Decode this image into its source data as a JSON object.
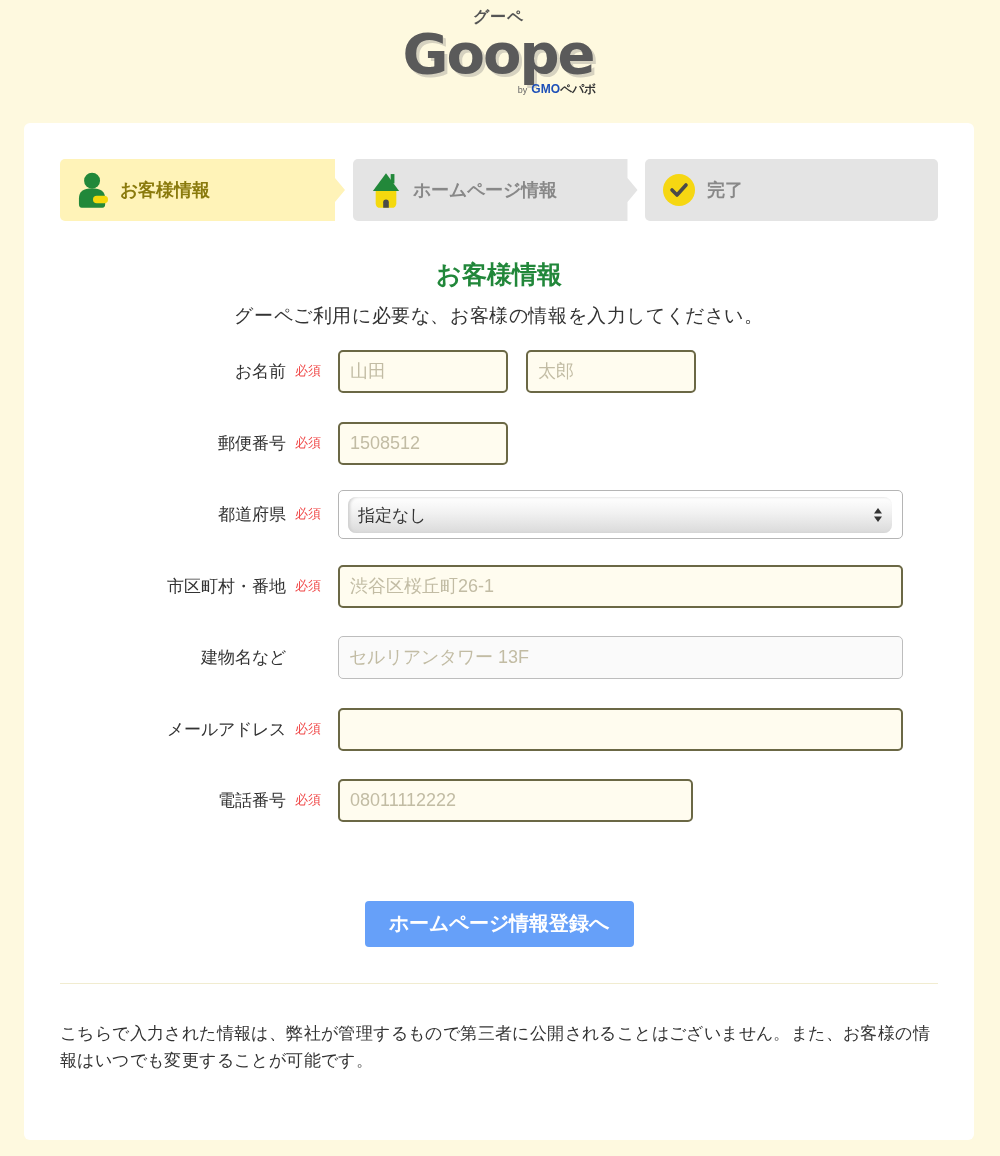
{
  "logo": {
    "kana": "グーペ",
    "wordmark": "Goope",
    "byline": "by",
    "company_prefix": "GMO",
    "company_name": "ペパボ"
  },
  "steps": [
    {
      "label": "お客様情報",
      "kind": "person",
      "selected": true
    },
    {
      "label": "ホームページ情報",
      "kind": "house",
      "selected": false
    },
    {
      "label": "完了",
      "kind": "check",
      "selected": false
    }
  ],
  "heading": "お客様情報",
  "intro": "グーペご利用に必要な、お客様の情報を入力してください。",
  "fields": [
    {
      "label": "お名前",
      "kind": "name",
      "required": true,
      "required_label": "必須",
      "inputs": [
        {
          "placeholder": "山田"
        },
        {
          "placeholder": "太郎"
        }
      ]
    },
    {
      "label": "郵便番号",
      "kind": "postal",
      "required": true,
      "required_label": "必須",
      "placeholder": "1508512"
    },
    {
      "label": "都道府県",
      "kind": "select",
      "required": true,
      "required_label": "必須",
      "value": "指定なし"
    },
    {
      "label": "市区町村・番地",
      "kind": "text",
      "required": true,
      "required_label": "必須",
      "placeholder": "渋谷区桜丘町26-1"
    },
    {
      "label": "建物名など",
      "kind": "text",
      "required": false,
      "placeholder": "セルリアンタワー 13F"
    },
    {
      "label": "メールアドレス",
      "kind": "text",
      "required": true,
      "required_label": "必須"
    },
    {
      "label": "電話番号",
      "kind": "phone",
      "required": true,
      "required_label": "必須",
      "placeholder": "08011112222"
    }
  ],
  "submit": "ホームページ情報登録へ",
  "note": "こちらで入力された情報は、弊社が管理するもので第三者に公開されることはございません。また、お客様の情報はいつでも変更することが可能です。"
}
